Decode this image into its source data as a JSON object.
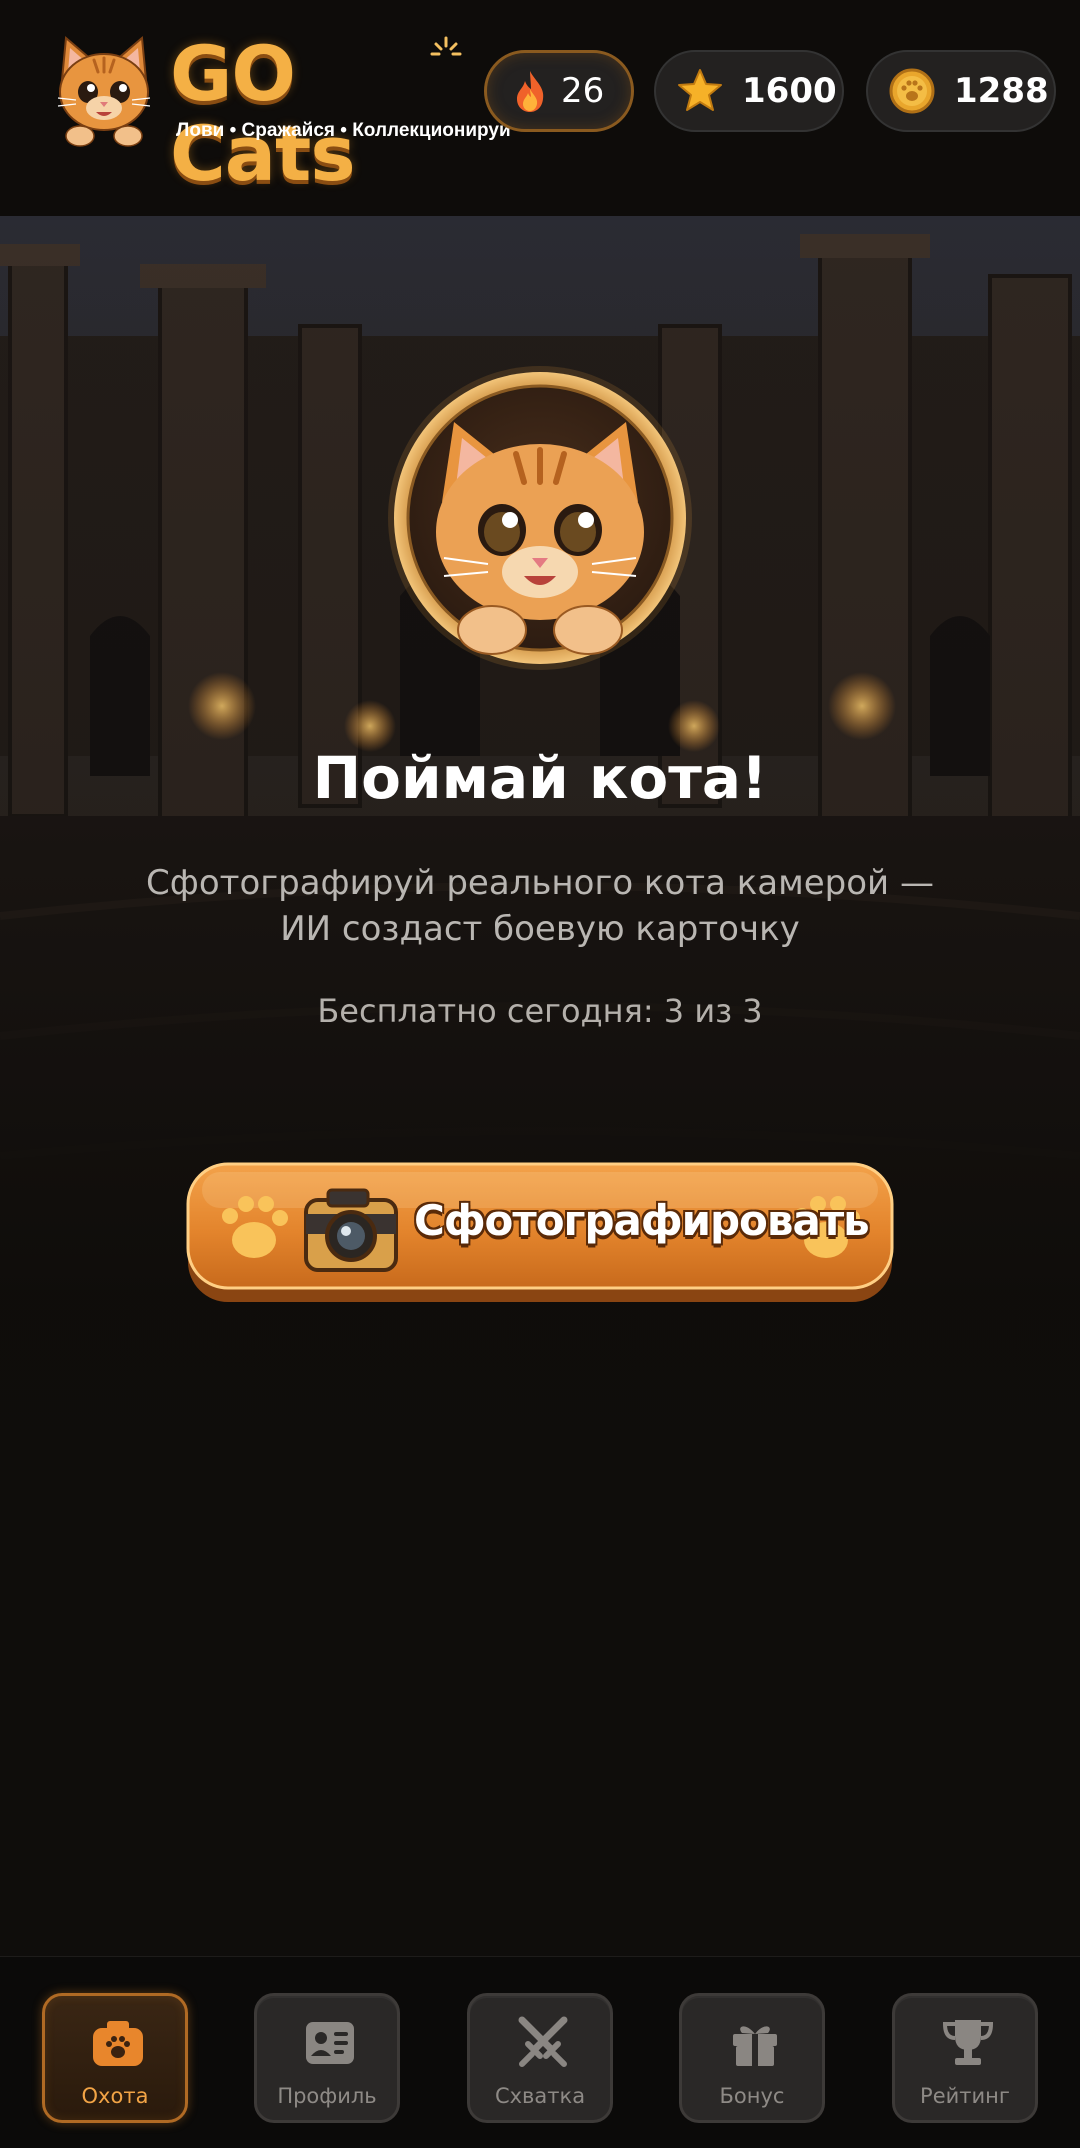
{
  "app": {
    "title": "GO Cats",
    "tagline": "Лови • Сражайся • Коллекционируй"
  },
  "stats": {
    "streak": "26",
    "stars": "1600",
    "coins": "1288"
  },
  "hunt": {
    "title": "Поймай кота!",
    "subtitle": "Сфотографируй реального кота камерой — ИИ создаст боевую карточку",
    "free_today": "Бесплатно сегодня: 3 из 3",
    "cta_label": "Сфотографировать"
  },
  "nav": {
    "items": [
      {
        "label": "Охота",
        "icon": "camera-paw-icon",
        "active": true
      },
      {
        "label": "Профиль",
        "icon": "profile-card-icon",
        "active": false
      },
      {
        "label": "Схватка",
        "icon": "crossed-swords-icon",
        "active": false
      },
      {
        "label": "Бонус",
        "icon": "gift-icon",
        "active": false
      },
      {
        "label": "Рейтинг",
        "icon": "trophy-icon",
        "active": false
      }
    ]
  },
  "colors": {
    "accent": "#f2a446",
    "brand_orange": "#e58a2e",
    "background": "#0d0b09"
  }
}
